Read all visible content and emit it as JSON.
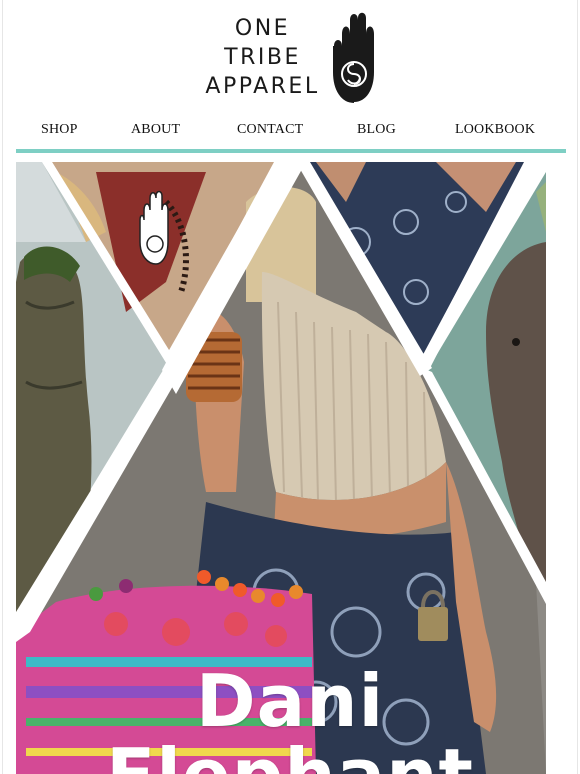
{
  "brand": {
    "name_lines": [
      "ONE",
      "TRIBE",
      "APPAREL"
    ],
    "logo_icon": "hamsa-hand-icon"
  },
  "nav": {
    "items": [
      {
        "label": "SHOP"
      },
      {
        "label": "ABOUT"
      },
      {
        "label": "CONTACT"
      },
      {
        "label": "BLOG"
      },
      {
        "label": "LOOKBOOK"
      }
    ]
  },
  "hero": {
    "title_lines": [
      "Dani",
      "Elephant"
    ]
  },
  "colors": {
    "accent": "#7ecfc4",
    "logo": "#1a1a1a"
  }
}
